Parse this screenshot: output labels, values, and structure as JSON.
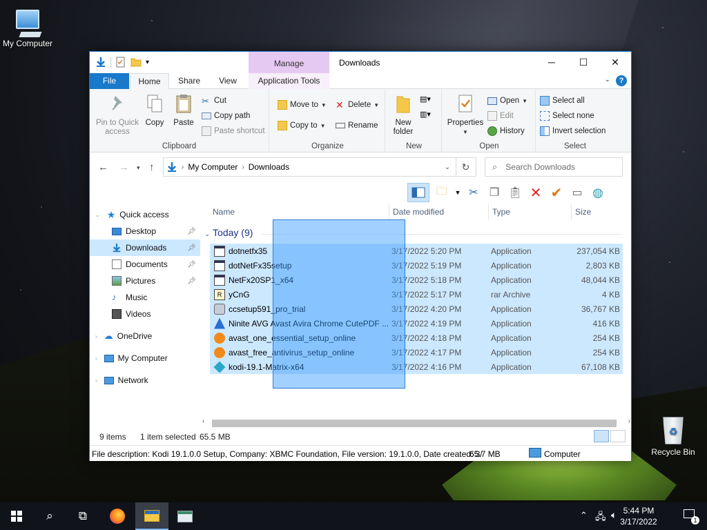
{
  "desktop": {
    "my_computer_label": "My Computer",
    "recycle_bin_label": "Recycle Bin"
  },
  "window": {
    "title": "Downloads",
    "context_tab_group": "Manage",
    "tabs": [
      "File",
      "Home",
      "Share",
      "View",
      "Application Tools"
    ],
    "help": "?"
  },
  "ribbon": {
    "clipboard": {
      "label": "Clipboard",
      "pin_quick_access": "Pin to Quick access",
      "copy": "Copy",
      "paste": "Paste",
      "cut": "Cut",
      "copy_path": "Copy path",
      "paste_shortcut": "Paste shortcut"
    },
    "organize": {
      "label": "Organize",
      "move_to": "Move to",
      "copy_to": "Copy to",
      "delete": "Delete",
      "rename": "Rename"
    },
    "new": {
      "label": "New",
      "new_folder": "New folder"
    },
    "open": {
      "label": "Open",
      "properties": "Properties",
      "open": "Open",
      "edit": "Edit",
      "history": "History"
    },
    "select": {
      "label": "Select",
      "select_all": "Select all",
      "select_none": "Select none",
      "invert_selection": "Invert selection"
    }
  },
  "address": {
    "crumbs": [
      "My Computer",
      "Downloads"
    ],
    "search_placeholder": "Search Downloads"
  },
  "nav": {
    "quick_access": "Quick access",
    "items": [
      {
        "label": "Desktop",
        "pinned": true
      },
      {
        "label": "Downloads",
        "pinned": true,
        "selected": true
      },
      {
        "label": "Documents",
        "pinned": true
      },
      {
        "label": "Pictures",
        "pinned": true
      },
      {
        "label": "Music",
        "pinned": false
      },
      {
        "label": "Videos",
        "pinned": false
      }
    ],
    "onedrive": "OneDrive",
    "my_computer": "My Computer",
    "network": "Network"
  },
  "filelist": {
    "columns": [
      "Name",
      "Date modified",
      "Type",
      "Size"
    ],
    "group_label": "Today (9)",
    "files": [
      {
        "name": "dotnetfx35",
        "date": "3/17/2022 5:20 PM",
        "type": "Application",
        "size": "237,054 KB",
        "icon": "installer-icon"
      },
      {
        "name": "dotNetFx35setup",
        "date": "3/17/2022 5:19 PM",
        "type": "Application",
        "size": "2,803 KB",
        "icon": "installer-icon"
      },
      {
        "name": "NetFx20SP1_x64",
        "date": "3/17/2022 5:18 PM",
        "type": "Application",
        "size": "48,044 KB",
        "icon": "installer-icon"
      },
      {
        "name": "yCnG",
        "date": "3/17/2022 5:17 PM",
        "type": "rar Archive",
        "size": "4 KB",
        "icon": "rar-icon"
      },
      {
        "name": "ccsetup591_pro_trial",
        "date": "3/17/2022 4:20 PM",
        "type": "Application",
        "size": "36,767 KB",
        "icon": "ccleaner-icon"
      },
      {
        "name": "Ninite AVG Avast Avira Chrome CutePDF ...",
        "date": "3/17/2022 4:19 PM",
        "type": "Application",
        "size": "416 KB",
        "icon": "ninite-icon"
      },
      {
        "name": "avast_one_essential_setup_online",
        "date": "3/17/2022 4:18 PM",
        "type": "Application",
        "size": "254 KB",
        "icon": "avast-icon"
      },
      {
        "name": "avast_free_antivirus_setup_online",
        "date": "3/17/2022 4:17 PM",
        "type": "Application",
        "size": "254 KB",
        "icon": "avast-icon"
      },
      {
        "name": "kodi-19.1-Matrix-x64",
        "date": "3/17/2022 4:16 PM",
        "type": "Application",
        "size": "67,108 KB",
        "icon": "kodi-icon"
      }
    ]
  },
  "status": {
    "item_count": "9 items",
    "selected": "1 item selected",
    "selected_size": "65.5 MB"
  },
  "details_bar": {
    "description": "File description: Kodi 19.1.0.0 Setup, Company: XBMC Foundation, File version: 19.1.0.0, Date created: 3/",
    "size": "65.7 MB",
    "location": "Computer"
  },
  "taskbar": {
    "time": "5:44 PM",
    "date": "3/17/2022",
    "notification_count": "1"
  }
}
